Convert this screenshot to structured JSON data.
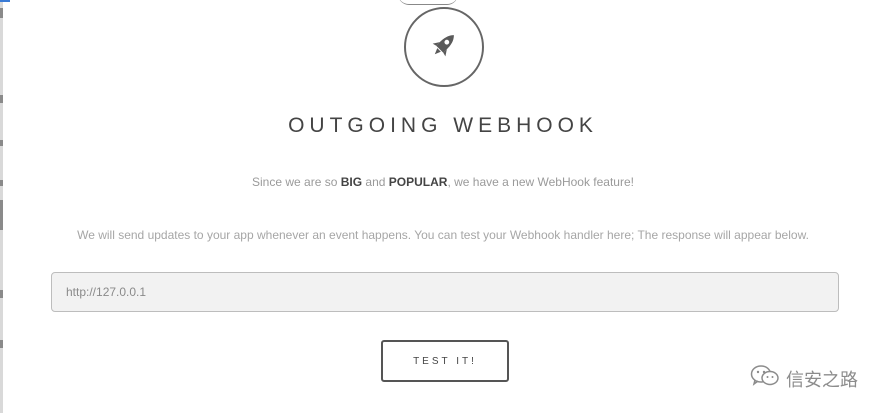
{
  "dialog": {
    "title": "OUTGOING WEBHOOK",
    "intro_prefix": "Since we are so ",
    "intro_big": "BIG",
    "intro_and": " and ",
    "intro_popular": "POPULAR",
    "intro_suffix": ", we have a new WebHook feature!",
    "description": "We will send updates to your app whenever an event happens. You can test your Webhook handler here; The response will appear below.",
    "url_input": {
      "placeholder": "http://127.0.0.1"
    },
    "test_button_label": "TEST IT!",
    "icon": "rocket-icon"
  },
  "watermark": {
    "text": "信安之路",
    "icon": "wechat-icon"
  },
  "colors": {
    "text_dark": "#444444",
    "text_muted": "#9a9a9a",
    "input_bg": "#f2f2f2"
  }
}
